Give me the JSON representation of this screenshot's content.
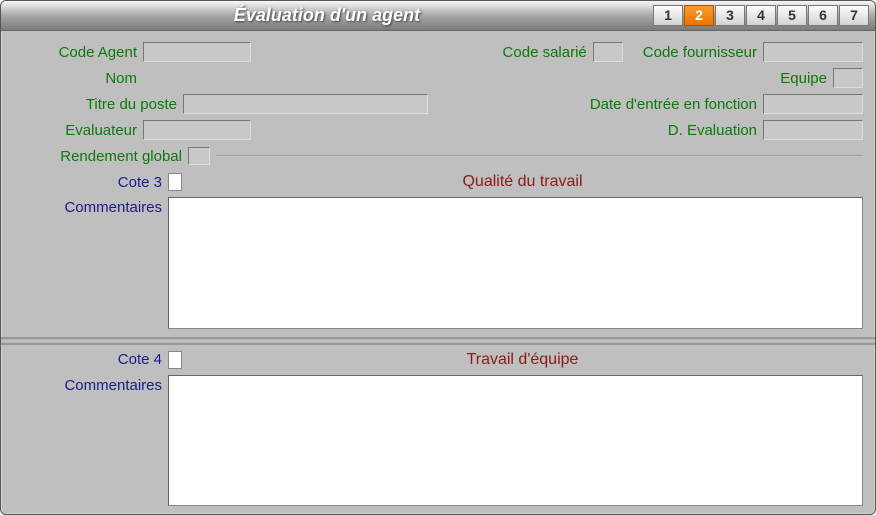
{
  "title": "Évaluation d'un agent",
  "tabs": [
    "1",
    "2",
    "3",
    "4",
    "5",
    "6",
    "7"
  ],
  "active_tab": "2",
  "labels": {
    "code_agent": "Code Agent",
    "code_salarie": "Code salarié",
    "code_fournisseur": "Code fournisseur",
    "nom": "Nom",
    "equipe": "Equipe",
    "titre_poste": "Titre du poste",
    "date_entree": "Date d'entrée en fonction",
    "evaluateur": "Evaluateur",
    "d_evaluation": "D. Evaluation",
    "rendement_global": "Rendement global",
    "cote3": "Cote 3",
    "cote4": "Cote 4",
    "commentaires": "Commentaires"
  },
  "sections": {
    "qualite": "Qualité du travail",
    "equipe": "Travail d'équipe"
  },
  "values": {
    "code_agent": "",
    "code_salarie": "",
    "code_fournisseur": "",
    "nom": "",
    "equipe": "",
    "titre_poste": "",
    "date_entree": "",
    "evaluateur": "",
    "d_evaluation": "",
    "rendement_global": "",
    "cote3": "",
    "cote4": "",
    "comments3": "",
    "comments4": ""
  }
}
